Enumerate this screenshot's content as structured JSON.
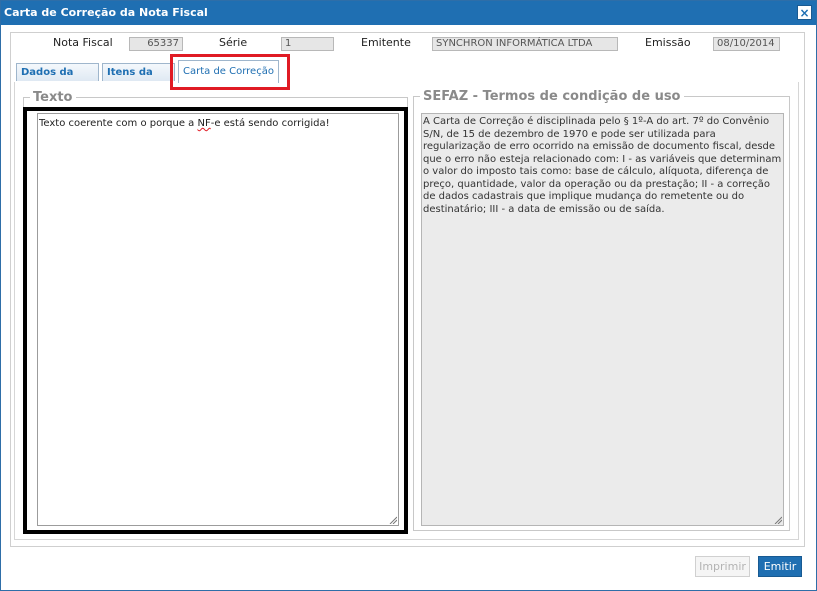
{
  "window": {
    "title": "Carta de Correção da Nota Fiscal",
    "close_glyph": "×"
  },
  "header": {
    "nota_fiscal_label": "Nota Fiscal",
    "nota_fiscal_value": "65337",
    "serie_label": "Série",
    "serie_value": "1",
    "emitente_label": "Emitente",
    "emitente_value": "SYNCHRON INFORMÁTICA LTDA",
    "emissao_label": "Emissão",
    "emissao_value": "08/10/2014"
  },
  "tabs": [
    {
      "label": "Dados da NF-e",
      "active": false
    },
    {
      "label": "Itens da Nota",
      "active": false
    },
    {
      "label": "Carta de Correção",
      "active": true
    }
  ],
  "texto": {
    "legend": "Texto",
    "value_before": "Texto coerente com o porque a ",
    "value_flagged": "NF",
    "value_after": "-e está sendo corrigida!"
  },
  "sefaz": {
    "legend": "SEFAZ - Termos de condição de uso",
    "text": "A Carta de Correção é disciplinada pelo § 1º-A do art. 7º do Convênio S/N, de 15 de dezembro de 1970 e pode ser utilizada para regularização de erro ocorrido na emissão de documento fiscal, desde que o erro não esteja relacionado com: I - as variáveis que determinam o valor do imposto tais como: base de cálculo, alíquota, diferença de preço, quantidade, valor da operação ou da prestação; II - a correção de dados cadastrais que implique mudança do remetente ou do destinatário; III - a data de emissão ou de saída."
  },
  "buttons": {
    "imprimir": "Imprimir",
    "emitir": "Emitir"
  },
  "colors": {
    "title_bar": "#1f6fb2",
    "highlight": "#e01b24",
    "primary_button": "#1f6fb2"
  },
  "icons": {
    "close": "close-icon",
    "resize": "resize-grip-icon"
  }
}
